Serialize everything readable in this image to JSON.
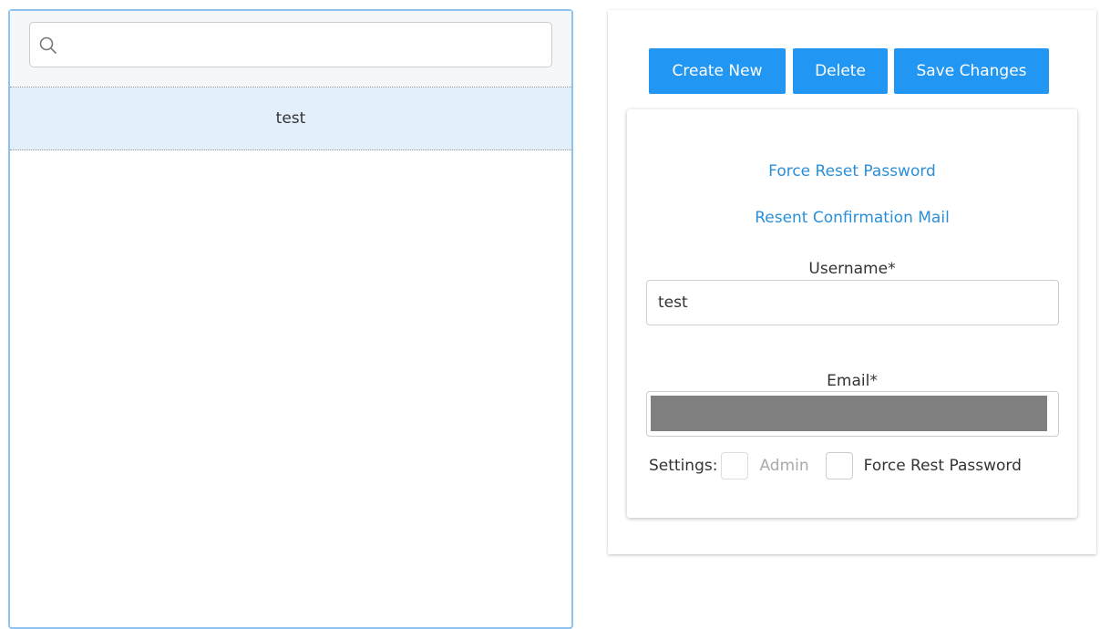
{
  "search": {
    "placeholder": "",
    "value": ""
  },
  "list": {
    "items": [
      {
        "label": "test",
        "selected": true
      }
    ]
  },
  "toolbar": {
    "create_label": "Create New",
    "delete_label": "Delete",
    "save_label": "Save Changes"
  },
  "form": {
    "force_reset_link": "Force Reset Password",
    "resent_confirmation_link": "Resent Confirmation Mail",
    "username_label": "Username*",
    "username_value": "test",
    "email_label": "Email*",
    "settings_label": "Settings:",
    "admin_label": "Admin",
    "admin_checked": false,
    "admin_disabled": true,
    "force_rest_label": "Force Rest Password",
    "force_rest_checked": false
  },
  "icons": {
    "search": "search-icon"
  },
  "colors": {
    "accent": "#2196f3",
    "link": "#2b8fd8",
    "selected_row": "#e3f0fb",
    "panel_border": "#8ec3f0"
  }
}
